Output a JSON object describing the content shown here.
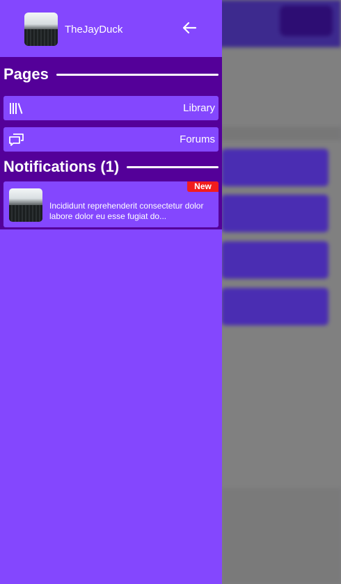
{
  "drawer": {
    "username": "TheJayDuck",
    "avatar_icon": "profile-photo-icon",
    "back_icon": "arrow-left-icon"
  },
  "pages": {
    "title": "Pages",
    "items": [
      {
        "label": "Library",
        "icon": "books-icon"
      },
      {
        "label": "Forums",
        "icon": "chat-bubbles-icon"
      }
    ]
  },
  "notifications": {
    "title": "Notifications (1)",
    "items": [
      {
        "badge": "New",
        "text": "Incididunt reprehenderit consectetur dolor labore dolor eu esse fugiat do...",
        "thumb_icon": "forest-thumbnail-icon"
      }
    ]
  },
  "colors": {
    "drawer_bg": "#8447fe",
    "section_bg": "#540099",
    "badge_bg": "#f21d1d",
    "overlay_bg": "#808080"
  }
}
